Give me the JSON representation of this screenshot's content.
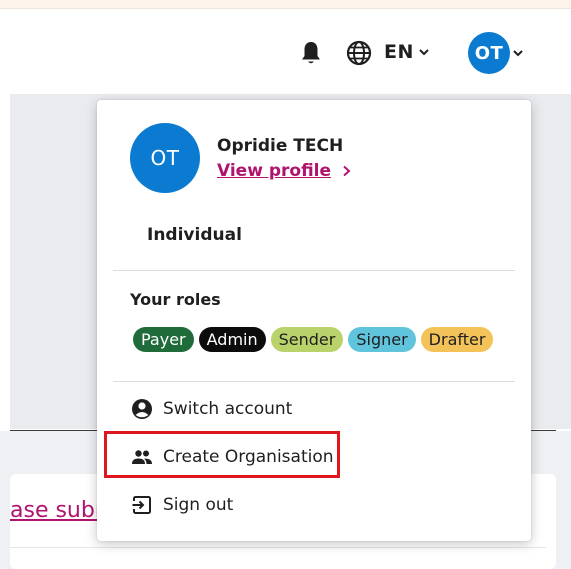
{
  "header": {
    "language": "EN",
    "avatar_initials": "OT"
  },
  "background": {
    "link_fragment": "ase subr"
  },
  "menu": {
    "avatar_initials": "OT",
    "user_name": "Opridie TECH",
    "view_profile": "View profile",
    "account_type": "Individual",
    "roles_title": "Your roles",
    "roles": [
      {
        "label": "Payer",
        "bg": "#1f6b3a",
        "fg": "#ffffff"
      },
      {
        "label": "Admin",
        "bg": "#0c0c0c",
        "fg": "#ffffff"
      },
      {
        "label": "Sender",
        "bg": "#b9d36a",
        "fg": "#1f1f1f"
      },
      {
        "label": "Signer",
        "bg": "#5fc4dc",
        "fg": "#1f1f1f"
      },
      {
        "label": "Drafter",
        "bg": "#f3c35a",
        "fg": "#1f1f1f"
      }
    ],
    "items": [
      {
        "label": "Switch account",
        "icon": "account-circle-icon"
      },
      {
        "label": "Create Organisation",
        "icon": "people-icon"
      },
      {
        "label": "Sign out",
        "icon": "sign-out-icon"
      }
    ]
  },
  "colors": {
    "brand_blue": "#0b7bd1",
    "link_magenta": "#b0136e",
    "highlight_red": "#e0161e"
  }
}
